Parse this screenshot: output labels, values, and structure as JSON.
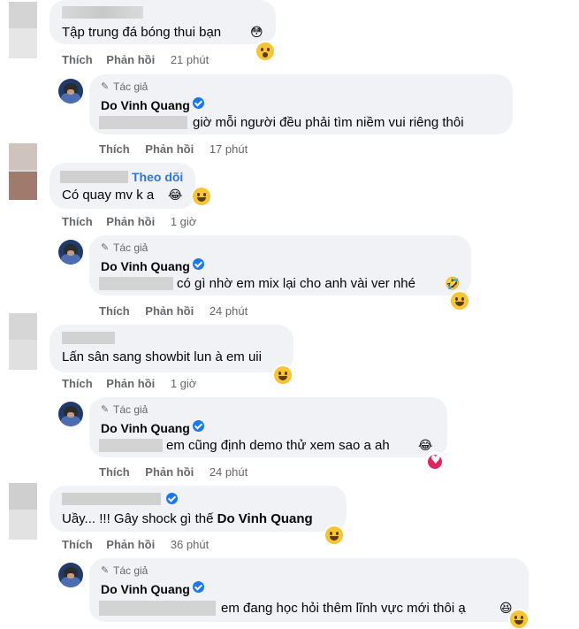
{
  "labels": {
    "like": "Thích",
    "reply": "Phản hồi",
    "author_badge": "Tác giả",
    "follow": "Theo dõi"
  },
  "author": {
    "name": "Do Vinh Quang"
  },
  "comments": [
    {
      "text": "Tập trung đá bóng thui bạn",
      "time": "21 phút",
      "inline_emoji": "😳",
      "reaction": "wow"
    },
    {
      "text": "giờ mỗi người đều phải tìm niềm vui riêng thôi",
      "time": "17 phút"
    },
    {
      "text": "Có quay mv k a",
      "time": "1 giờ",
      "inline_emoji": "😂",
      "reaction": "haha"
    },
    {
      "text": "có gì nhờ em mix lại cho anh vài ver nhé",
      "time": "24 phút",
      "inline_emoji": "🤣",
      "reaction": "haha"
    },
    {
      "text": "Lấn sân sang showbit lun à em uii",
      "time": "1 giờ",
      "reaction": "haha"
    },
    {
      "text": "em cũng định demo thử xem sao a ah",
      "time": "24 phút",
      "inline_emoji": "😂",
      "reaction": "love"
    },
    {
      "text_prefix": "Uầy... !!! Gây shock gì thế ",
      "mention": "Do Vinh Quang",
      "time": "36 phút",
      "reaction": "haha"
    },
    {
      "text": "em đang học hỏi thêm lĩnh vực mới thôi ạ",
      "inline_emoji": "😆",
      "reaction": "haha"
    }
  ]
}
